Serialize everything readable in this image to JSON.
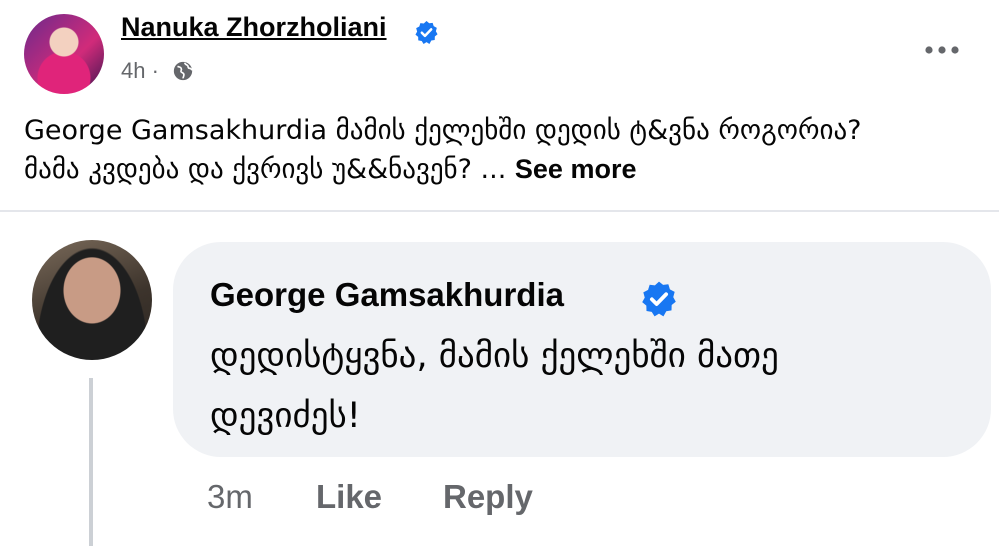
{
  "post": {
    "author_name": "Nanuka Zhorzholiani",
    "time": "4h ·",
    "text_line1": "George Gamsakhurdia  მამის ქელეხში დედის ტ&ვნა როგორია?",
    "text_line2": "მამა კვდება  და ქვრივს უ&&ნავენ? ...",
    "see_more_label": "See more"
  },
  "comment": {
    "author_name": "George Gamsakhurdia",
    "text_line1": "დედისტყვნა, მამის ქელეხში მათე",
    "text_line2": "დევიძეს!",
    "time": "3m",
    "like_label": "Like",
    "reply_label": "Reply"
  },
  "colors": {
    "verified": "#1877f2",
    "secondary_text": "#65676b",
    "bubble": "#f0f2f5"
  }
}
